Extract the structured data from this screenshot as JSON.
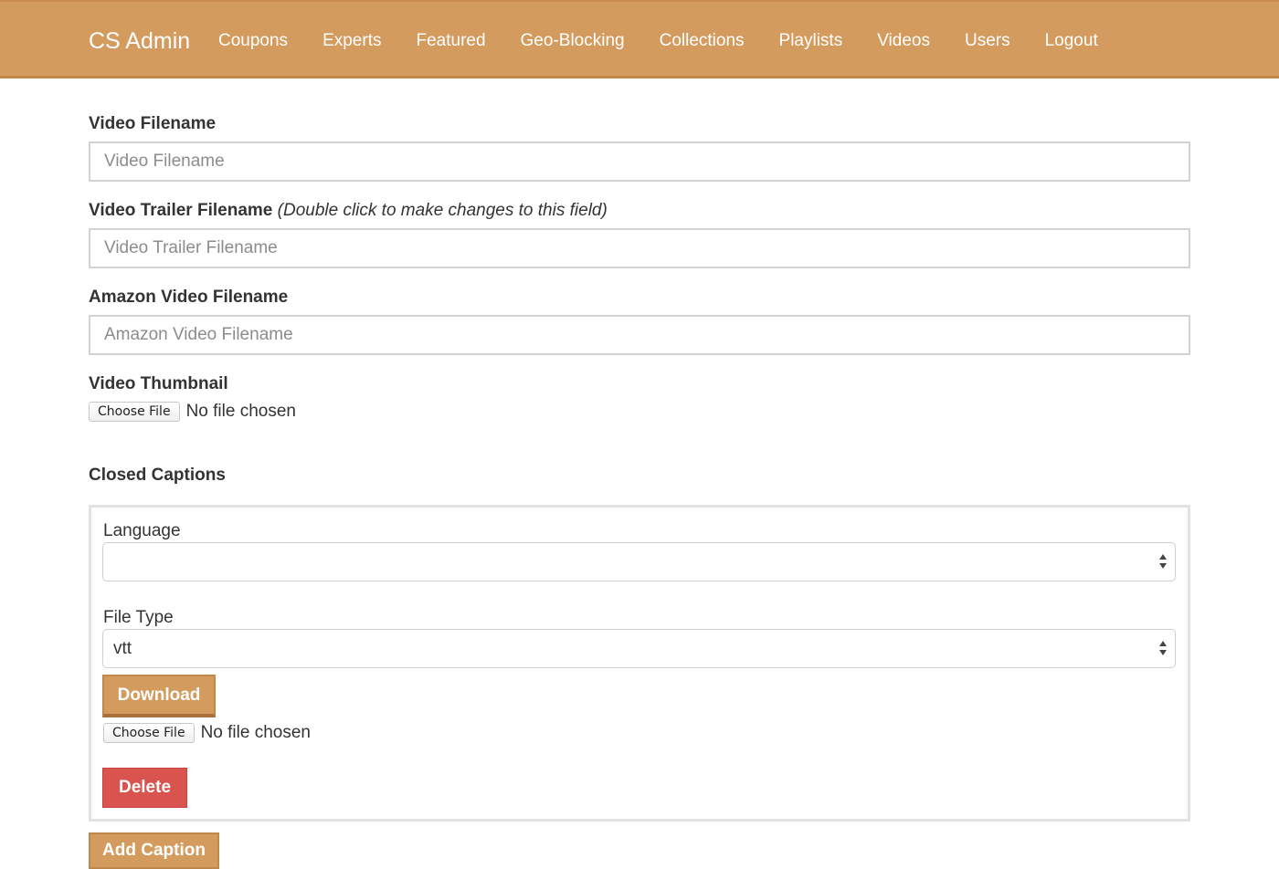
{
  "navbar": {
    "brand": "CS Admin",
    "items": [
      "Coupons",
      "Experts",
      "Featured",
      "Geo-Blocking",
      "Collections",
      "Playlists",
      "Videos",
      "Users",
      "Logout"
    ]
  },
  "form": {
    "video_filename": {
      "label": "Video Filename",
      "placeholder": "Video Filename",
      "value": ""
    },
    "trailer_filename": {
      "label": "Video Trailer Filename",
      "hint": "(Double click to make changes to this field)",
      "placeholder": "Video Trailer Filename",
      "value": ""
    },
    "amazon_filename": {
      "label": "Amazon Video Filename",
      "placeholder": "Amazon Video Filename",
      "value": ""
    },
    "thumbnail": {
      "label": "Video Thumbnail",
      "button": "Choose File",
      "status": "No file chosen"
    }
  },
  "captions": {
    "heading": "Closed Captions",
    "language": {
      "label": "Language",
      "selected": ""
    },
    "file_type": {
      "label": "File Type",
      "selected": "vtt"
    },
    "download_label": "Download",
    "file": {
      "button": "Choose File",
      "status": "No file chosen"
    },
    "delete_label": "Delete",
    "add_label": "Add Caption"
  },
  "colors": {
    "accent": "#d49b5e",
    "danger": "#d9534f"
  }
}
